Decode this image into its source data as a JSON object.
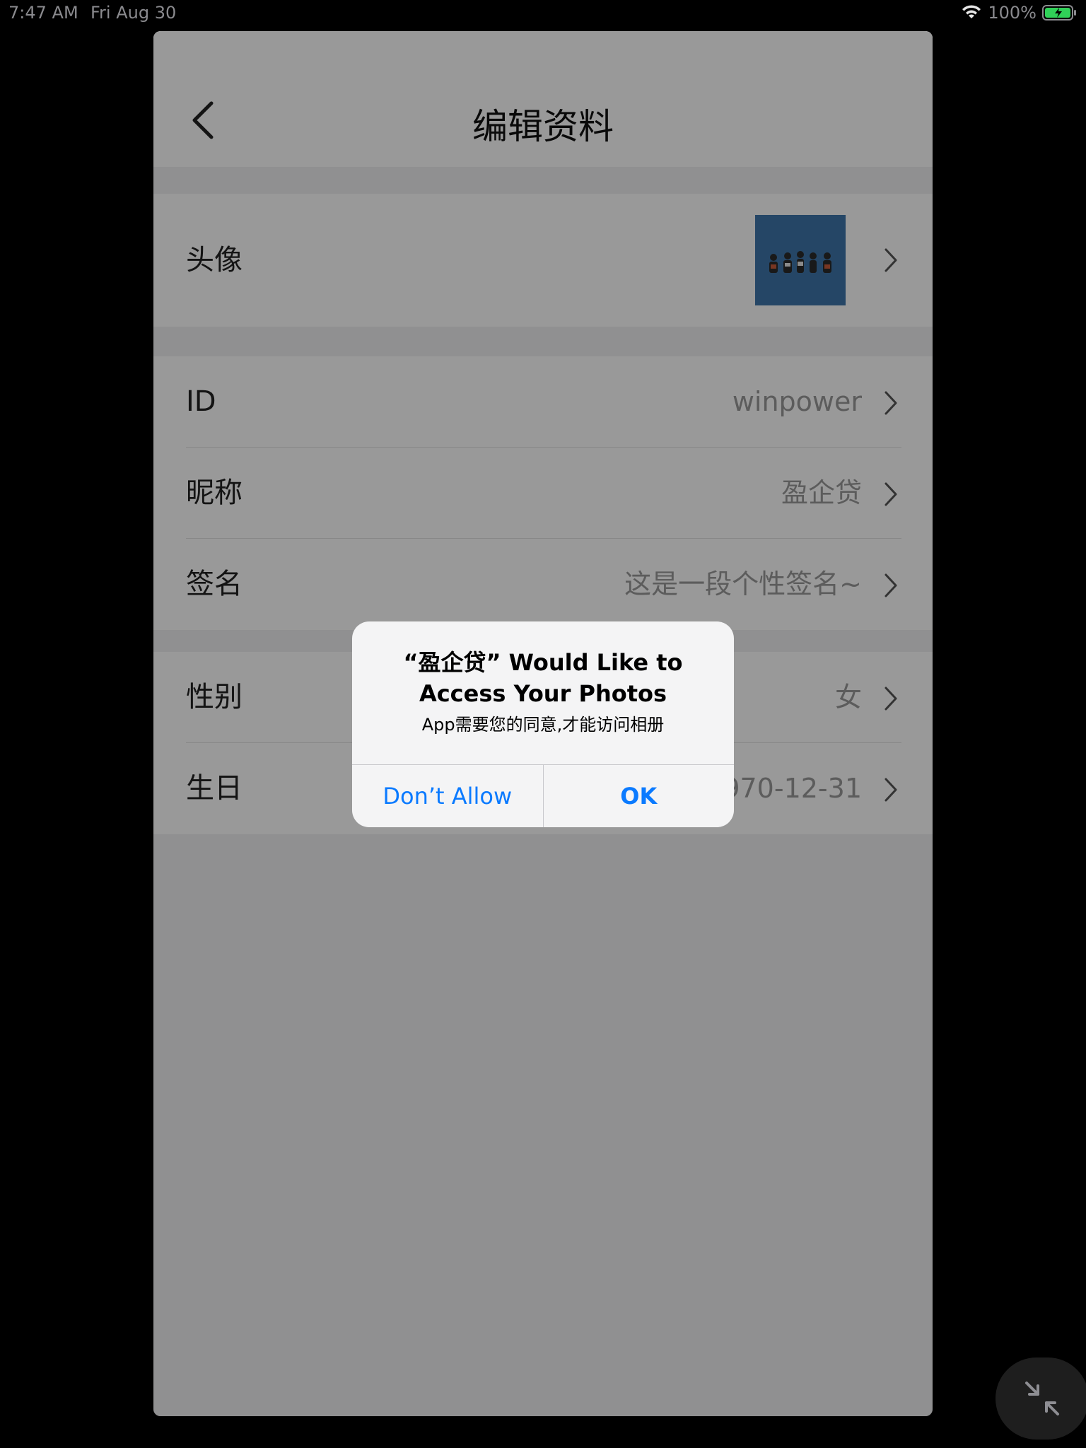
{
  "status_bar": {
    "time": "7:47 AM",
    "date": "Fri Aug 30",
    "battery": "100%"
  },
  "nav": {
    "title": "编辑资料",
    "back_icon": "chevron-left-icon"
  },
  "profile": {
    "avatar_row": {
      "label": "头像"
    },
    "info_rows": [
      {
        "label": "ID",
        "value": "winpower"
      },
      {
        "label": "昵称",
        "value": "盈企贷"
      },
      {
        "label": "签名",
        "value": "这是一段个性签名~"
      }
    ],
    "personal_rows": [
      {
        "label": "性别",
        "value": "女"
      },
      {
        "label": "生日",
        "value": "1970-12-31"
      }
    ]
  },
  "alert": {
    "title": "“盈企贷” Would Like to Access Your Photos",
    "message": "App需要您的同意,才能访问相册",
    "deny_label": "Don’t Allow",
    "ok_label": "OK",
    "button_color": "#0a7aff"
  },
  "floating_button": {
    "icon": "collapse-arrows-icon"
  }
}
